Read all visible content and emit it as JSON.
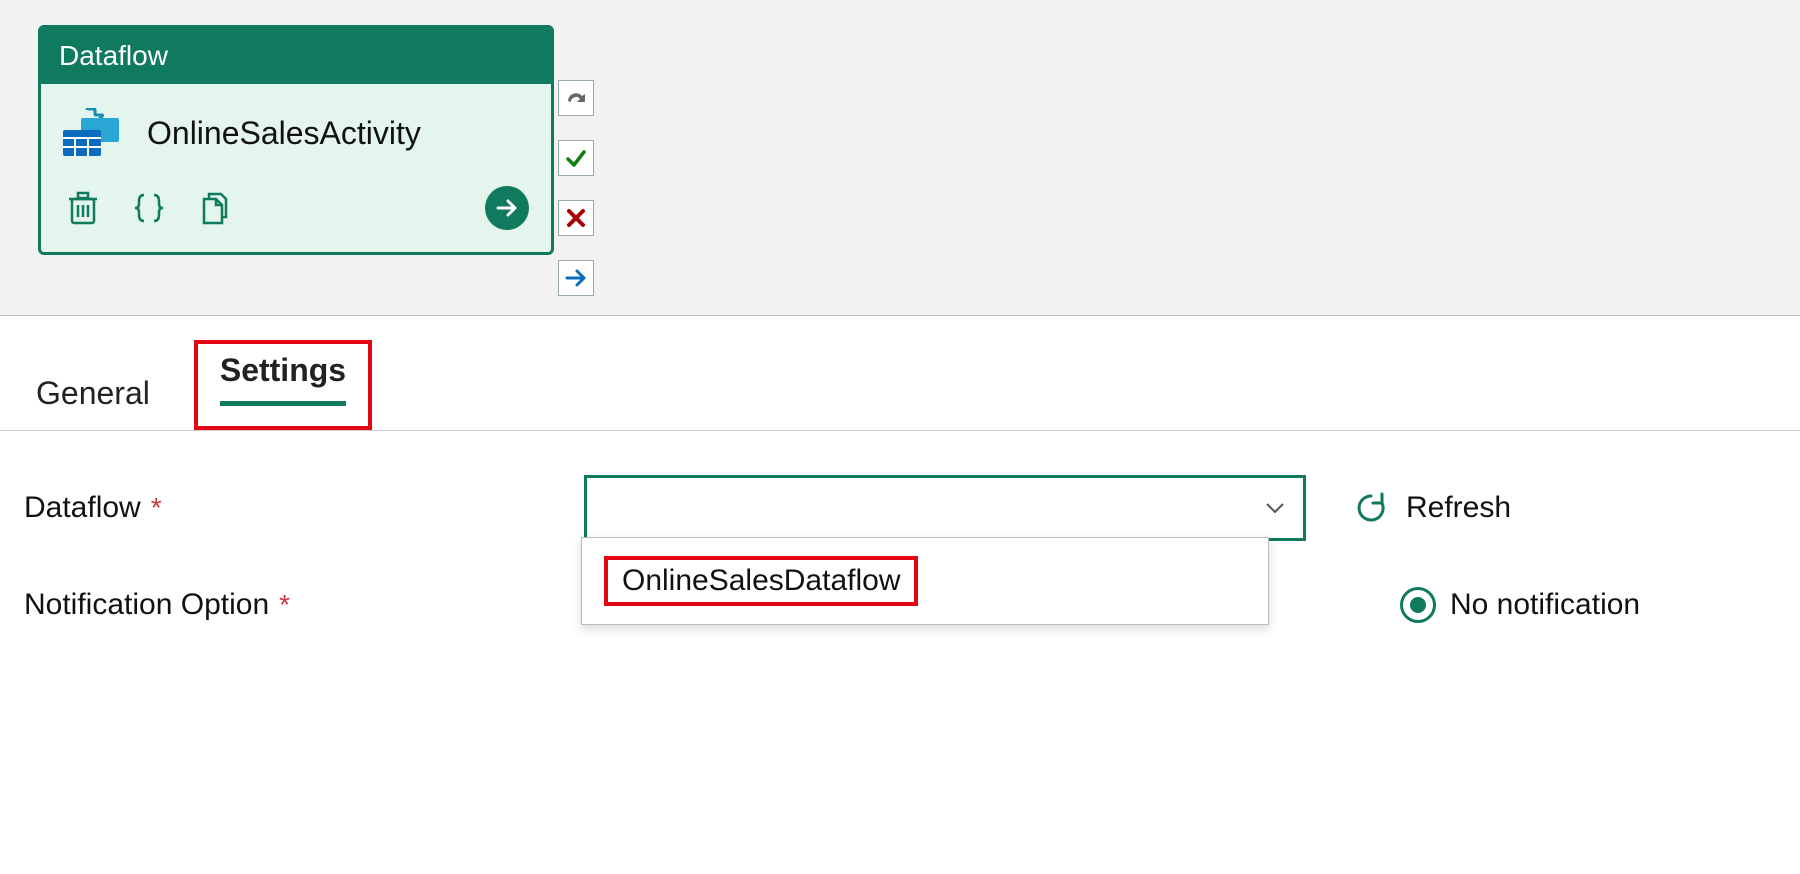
{
  "activity": {
    "header": "Dataflow",
    "name": "OnlineSalesActivity"
  },
  "tabs": {
    "general": "General",
    "settings": "Settings"
  },
  "form": {
    "dataflow_label": "Dataflow",
    "dataflow_value": "",
    "dataflow_options": [
      "OnlineSalesDataflow"
    ],
    "refresh_label": "Refresh",
    "notification_label": "Notification Option",
    "notification_selected": "No notification"
  }
}
